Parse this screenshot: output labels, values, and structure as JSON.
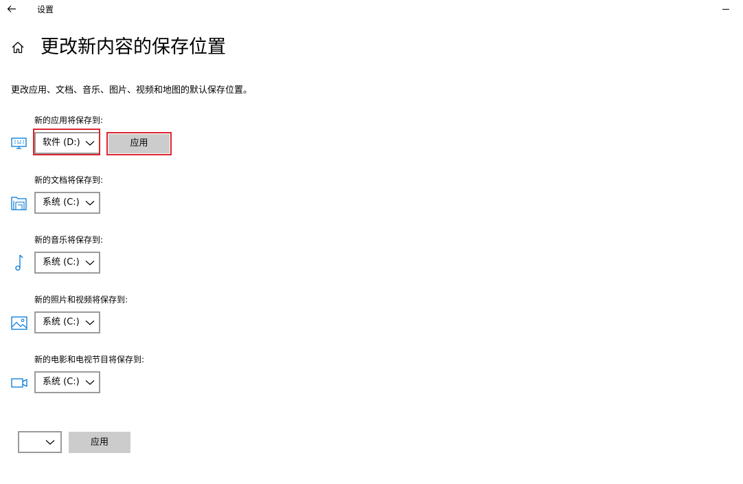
{
  "window": {
    "title": "设置"
  },
  "page": {
    "title": "更改新内容的保存位置",
    "description": "更改应用、文档、音乐、图片、视频和地图的默认保存位置。"
  },
  "sections": [
    {
      "label": "新的应用将保存到:",
      "selected": "软件 (D:)",
      "icon": "monitor-icon",
      "apply_label": "应用"
    },
    {
      "label": "新的文档将保存到:",
      "selected": "系统 (C:)",
      "icon": "documents-folder-icon"
    },
    {
      "label": "新的音乐将保存到:",
      "selected": "系统 (C:)",
      "icon": "music-note-icon"
    },
    {
      "label": "新的照片和视频将保存到:",
      "selected": "系统 (C:)",
      "icon": "picture-icon"
    },
    {
      "label": "新的电影和电视节目将保存到:",
      "selected": "系统 (C:)",
      "icon": "video-camera-icon"
    }
  ],
  "maps": {
    "selected": "",
    "apply_label": "应用"
  },
  "colors": {
    "accent": "#0078d7",
    "highlight": "#d9262e",
    "button_bg": "#cccccc",
    "dropdown_border": "#9a9a9a"
  }
}
